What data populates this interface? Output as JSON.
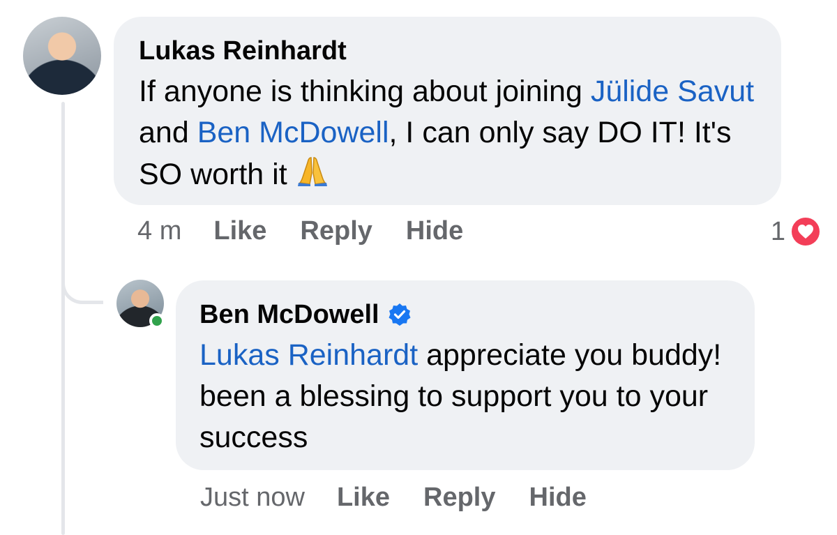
{
  "comment": {
    "author": "Lukas Reinhardt",
    "text_parts": [
      {
        "type": "text",
        "value": "If anyone is thinking about joining "
      },
      {
        "type": "mention",
        "value": "Jülide Savut"
      },
      {
        "type": "text",
        "value": " and "
      },
      {
        "type": "mention",
        "value": "Ben McDowell"
      },
      {
        "type": "text",
        "value": ", I can only say DO IT! It's SO worth it "
      }
    ],
    "emoji": "folded-hands-icon",
    "timestamp": "4 m",
    "actions": {
      "like": "Like",
      "reply": "Reply",
      "hide": "Hide"
    },
    "reaction_count": "1",
    "reaction_icon": "heart-icon"
  },
  "reply": {
    "author": "Ben McDowell",
    "verified": true,
    "text_parts": [
      {
        "type": "mention",
        "value": "Lukas Reinhardt"
      },
      {
        "type": "text",
        "value": " appreciate you buddy! been a blessing to support you to your success"
      }
    ],
    "timestamp": "Just now",
    "actions": {
      "like": "Like",
      "reply": "Reply",
      "hide": "Hide"
    },
    "online": true
  },
  "colors": {
    "bubble": "#eff1f4",
    "mention": "#1a62c4",
    "meta": "#65676b",
    "heart": "#f33e58",
    "online": "#31a24c",
    "verified": "#1877f2"
  }
}
